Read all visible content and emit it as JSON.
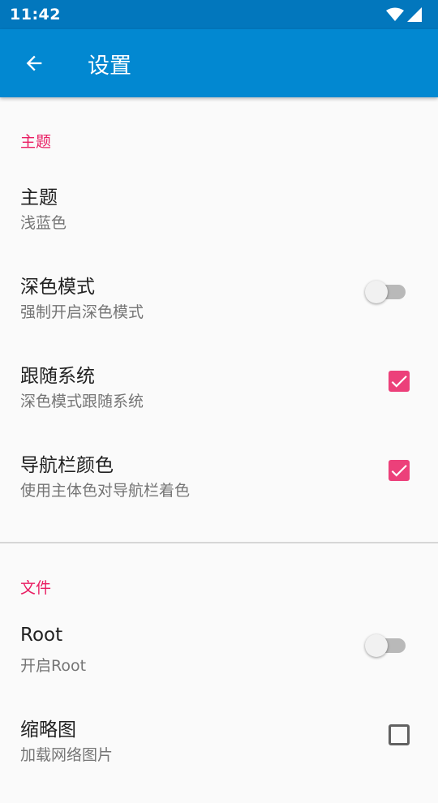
{
  "status_bar": {
    "time": "11:42"
  },
  "app_bar": {
    "title": "设置"
  },
  "sections": [
    {
      "header": "主题"
    },
    {
      "header": "文件"
    }
  ],
  "prefs": {
    "theme": {
      "title": "主题",
      "summary": "浅蓝色"
    },
    "dark_mode": {
      "title": "深色模式",
      "summary": "强制开启深色模式",
      "checked": false
    },
    "follow_system": {
      "title": "跟随系统",
      "summary": "深色模式跟随系统",
      "checked": true
    },
    "nav_bar_color": {
      "title": "导航栏颜色",
      "summary": "使用主体色对导航栏着色",
      "checked": true
    },
    "root": {
      "title": "Root",
      "summary": "开启Root",
      "checked": false
    },
    "thumbnail": {
      "title": "缩略图",
      "summary": "加载网络图片",
      "checked": false
    }
  },
  "colors": {
    "primary": "#0288d1",
    "primary_dark": "#0277bd",
    "accent": "#e91e63",
    "checkbox": "#ec407a"
  },
  "icons": {
    "back": "arrow-left-icon",
    "wifi": "wifi-icon",
    "signal": "cell-signal-icon",
    "check": "check-icon"
  }
}
